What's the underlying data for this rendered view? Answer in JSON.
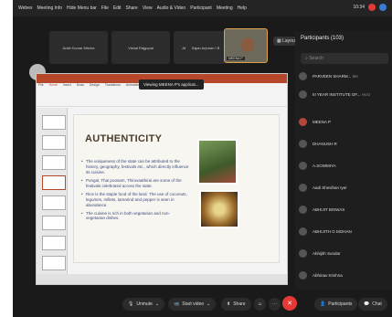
{
  "menubar": {
    "items": [
      "Webex",
      "Meeting Info",
      "Hide Menu bar",
      "File",
      "Edit",
      "Share",
      "View",
      "Audio & Video",
      "Participant",
      "Meeting",
      "Help"
    ],
    "time": "10:34"
  },
  "thumbnails": [
    {
      "name": "Ankit Kumar Mishra"
    },
    {
      "name": "Vishal Rajgopal"
    },
    {
      "name": "ADITYA THAKRE"
    },
    {
      "name": "Sajan Arjunan I B"
    }
  ],
  "active_speaker": {
    "name": "MEENA P"
  },
  "layout_label": "Layout",
  "viewing_banner": "Viewing MEENA P's applicat...",
  "ppt": {
    "tabs": [
      "File",
      "Home",
      "Insert",
      "Draw",
      "Design",
      "Transitions",
      "Animations",
      "Slide Show",
      "Review",
      "View",
      "Help"
    ]
  },
  "slide": {
    "title": "AUTHENTICITY",
    "bullets": [
      "The uniqueness of the state can be attributed to the history, geography, festivals etc., which directly influence its cuisine.",
      "Pongal, Thai poosam, Thiruvaathirai are some of the festivals celebrated across the state.",
      "Rice is the staple food of the land. The use of coconuts, legumes, millets, tamarind and pepper is seen in abundance.",
      "The cuisine is rich in both vegetarian and non-vegetarian dishes."
    ]
  },
  "participants": {
    "header": "Participants (103)",
    "search_placeholder": "Search",
    "list": [
      {
        "name": "PARVEEN SHARM...",
        "role": "Me"
      },
      {
        "name": "III YEAR INSTITUTE OF...",
        "role": "Host"
      },
      {
        "name": "MEENA P",
        "role": ""
      },
      {
        "name": "DHANUSH R",
        "role": ""
      },
      {
        "name": "A.SOWMIYA",
        "role": ""
      },
      {
        "name": "Aadi Shesihan Iyer",
        "role": ""
      },
      {
        "name": "ABHIJIT BISWAS",
        "role": ""
      },
      {
        "name": "ABHIJITH G MOHAN",
        "role": ""
      },
      {
        "name": "Abhijith Sundar",
        "role": ""
      },
      {
        "name": "Abhinav Krishna",
        "role": ""
      }
    ]
  },
  "controls": {
    "unmute": "Unmute",
    "start_video": "Start video",
    "share": "Share",
    "participants": "Participants",
    "chat": "Chat"
  }
}
